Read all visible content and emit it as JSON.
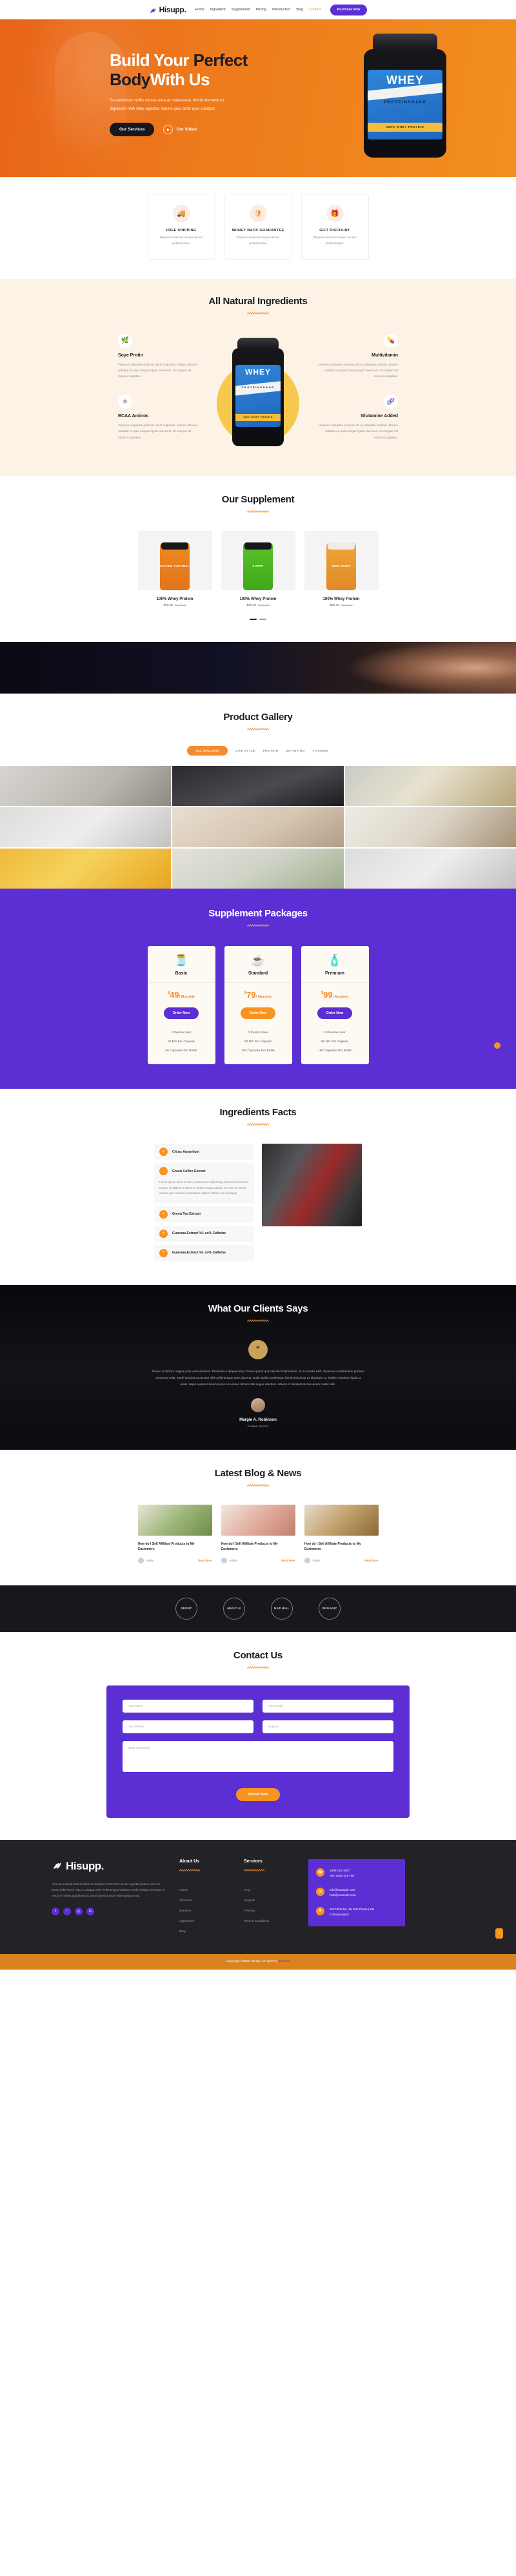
{
  "header": {
    "logo_text": "Hisupp.",
    "logo_icon": "leaf-icon",
    "nav": [
      {
        "label": "Home",
        "active": false
      },
      {
        "label": "Ingredient",
        "active": false
      },
      {
        "label": "Supplement",
        "active": false
      },
      {
        "label": "Pricing",
        "active": false
      },
      {
        "label": "Introduction",
        "active": false
      },
      {
        "label": "Blog",
        "active": false
      },
      {
        "label": "Contact",
        "active": true
      }
    ],
    "purchase_label": "Purchase Now"
  },
  "hero": {
    "title_line1_white": "Build Your ",
    "title_line1_dark": "Perfect",
    "title_line2_dark": "Body",
    "title_line2_white": "With Us",
    "subtitle": "Suspendisse mollis cursus urna at malesuada. Morbi elementum dignissim nibh vitae egestas mauris quis dolor quis volutpat.",
    "primary_button": "Our Services",
    "video_label": "Our Video!",
    "product_label_main": "WHEY",
    "product_label_sub": "PROTEINSHAKE",
    "product_label_band": "100% WHEY PROTEIN"
  },
  "features": [
    {
      "icon": "truck-icon",
      "title": "FREE SHIPPING",
      "desc": "Bliquam euismod neque vel leo pellentesque"
    },
    {
      "icon": "shield-icon",
      "title": "MONEY BACK GUARANTEE",
      "desc": "Bliquam euismod neque vel leo pellentesque"
    },
    {
      "icon": "gift-icon",
      "title": "GIFT DISCOUNT",
      "desc": "Bliquam euismod neque vel leo pellentesque"
    }
  ],
  "natural": {
    "title": "All Natural Ingredients",
    "left": [
      {
        "icon": "leaf-icon",
        "glyph": "🌿",
        "title": "Soye Protin",
        "desc": "Vivamus vulputate pulvinar elit et vulputate. Nullam ultricies volutpat ex,quis congue ligula viverra et. Ut congue vel metus in dapibus."
      },
      {
        "icon": "atom-icon",
        "glyph": "⚛",
        "title": "BCAA Aminos",
        "desc": "Vivamus vulputate pulvinar elit et vulputate. Nullam ultricies volutpat ex,quis congue ligula viverra et. Ut congue vel metus in dapibus."
      }
    ],
    "right": [
      {
        "icon": "vitamin-bottle-icon",
        "glyph": "💊",
        "title": "Multivitamin",
        "desc": "Vivamus vulputate pulvinar elit et vulputate. Nullam ultricies volutpat ex,quis congue ligula viverra et. Ut congue vel metus in dapibus."
      },
      {
        "icon": "dna-icon",
        "glyph": "🧬",
        "title": "Glutamine Added",
        "desc": "Vivamus vulputate pulvinar elit et vulputate. Nullam ultricies volutpat ex,quis congue ligula viverra et. Ut congue vel metus in dapibus."
      }
    ],
    "product_label_main": "WHEY",
    "product_label_sub": "PROTEINSHAKE",
    "product_label_band": "100% WHEY PROTEIN"
  },
  "supplement": {
    "title": "Our Supplement",
    "products": [
      {
        "name": "100% Whey Protein",
        "price": "$95.00",
        "old_price": "$120.00",
        "tub_text": "SALTED CARAMEL",
        "tub_class": "orange"
      },
      {
        "name": "100% Whey Protein",
        "price": "$95.00",
        "old_price": "$120.00",
        "tub_text": "SUPPK",
        "tub_class": "green"
      },
      {
        "name": "100% Whey Protein",
        "price": "$95.00",
        "old_price": "$120.00",
        "tub_text": "100% WHEY",
        "tub_class": "amber"
      }
    ]
  },
  "gallery": {
    "title": "Product Gallery",
    "tabs": [
      {
        "label": "ALL GALLERY",
        "active": true
      },
      {
        "label": "LIFE STYLE",
        "active": false
      },
      {
        "label": "PROTEIN",
        "active": false
      },
      {
        "label": "NUTRITION",
        "active": false
      },
      {
        "label": "VITAMINS",
        "active": false
      }
    ]
  },
  "packages": {
    "title": "Supplement Packages",
    "plans": [
      {
        "icon": "green-jar-icon",
        "glyph": "🫙",
        "name": "Basic",
        "currency": "$",
        "price": "49",
        "period": "/ Monthly",
        "button": "Order Now",
        "button_style": "purple",
        "features": [
          "1 Person User",
          "30 MG Per Capsule",
          "60 Capsules Per Bottle"
        ]
      },
      {
        "icon": "coffee-cup-icon",
        "glyph": "☕",
        "name": "Standard",
        "currency": "$",
        "price": "79",
        "period": "/ Monthly",
        "button": "Order Now",
        "button_style": "orange",
        "features": [
          "3 Person User",
          "60 MG Per Capsule",
          "100 Capsules Per Bottle"
        ]
      },
      {
        "icon": "red-jar-icon",
        "glyph": "🧴",
        "name": "Premium",
        "currency": "$",
        "price": "99",
        "period": "/ Monthly",
        "button": "Order Now",
        "button_style": "purple",
        "features": [
          "10 Person User",
          "90 MG Per Capsule",
          "160 Capsules Per Bottle"
        ]
      }
    ]
  },
  "facts": {
    "title": "Ingredients Facts",
    "items": [
      {
        "title": "Citrus Aurantium",
        "open": false,
        "body": ""
      },
      {
        "title": "Green Coffee Extract",
        "open": true,
        "body": "Lorem ipsum dolor sit amet,consectetur adipisicing elit,sed do eiusmod tempor incididunt ut labore et dolore magna aliqua. Ut enim ad minim veniam,quis nostrud exercitation ullamco laboris nisi ut aliquip"
      },
      {
        "title": "Green Tea Extract",
        "open": false,
        "body": ""
      },
      {
        "title": "Guarana Extract %1 so% Caffeine",
        "open": false,
        "body": ""
      },
      {
        "title": "Guarana Extract %1 so% Caffeine",
        "open": false,
        "body": ""
      }
    ]
  },
  "testimonial": {
    "title": "What Our Clients Says",
    "badge_icon": "quote-icon",
    "quote": "Donec sit dictum magna pulvi vehicula lacus. Phasellus a aliquam erat. Donec ipsum quis nisi sit condimentum. At ac massa nibh. Vivamus condimentum pretium commodo nulla. Morbi suscipit accumsan nibh pellentesque ante placerat. Nulla facilisi scelerisque hendrerit lacinia ex dignissim at. Nullam maximus ligula ut amet nisipis euismod ipsum purus accumsan dictum felis augue interdum. Mauris et tincidunt dictum quam mattis felis.",
    "name": "Margie A. Robinson",
    "role": "Creative Director"
  },
  "blog": {
    "title": "Latest Blog & News",
    "posts": [
      {
        "title": "How do I Sell Affiliate Products to My Customers",
        "author": "Admin",
        "read_more": "Read More",
        "img": "b1"
      },
      {
        "title": "How do I Sell Affiliate Products to My Customers",
        "author": "Admin",
        "read_more": "Read More",
        "img": "b2"
      },
      {
        "title": "How do I Sell Affiliate Products to My Customers",
        "author": "Admin",
        "read_more": "Read More",
        "img": "b3"
      }
    ]
  },
  "brands": [
    {
      "label": "SPORT"
    },
    {
      "label": "MUSCLE"
    },
    {
      "label": "NATURAL"
    },
    {
      "label": "ORGANIC"
    }
  ],
  "contact": {
    "title": "Contact Us",
    "name_placeholder": "Your Name",
    "email_placeholder": "Your Email",
    "phone_placeholder": "Your Phone",
    "subject_placeholder": "Subject",
    "comments_placeholder": "Write comments",
    "submit_label": "Submit Now"
  },
  "footer": {
    "logo_text": "Hisupp.",
    "logo_icon": "leaf-icon",
    "desc": "Aenean pulvinar laoreet tellus ut tincidunt. Praesent a lectus egestas,finibus enim sit amet,mollis lorem. Sed a volutpat velit. Pellentesque habitant morbi tristique senectus et netus et malesuada fames ac turpis egestas proin vitae egestas erat.",
    "socials": [
      {
        "icon": "facebook-icon",
        "glyph": "f"
      },
      {
        "icon": "twitter-icon",
        "glyph": "ᵗ"
      },
      {
        "icon": "instagram-icon",
        "glyph": "◎"
      },
      {
        "icon": "google-plus-icon",
        "glyph": "G"
      }
    ],
    "col1": {
      "title": "About Us",
      "links": [
        "Home",
        "About Us",
        "Services",
        "Appoiment",
        "Blog"
      ]
    },
    "col2": {
      "title": "Services",
      "links": [
        "FAQ",
        "Support",
        "Privercy",
        "Term & Conditions"
      ]
    },
    "contact_card": [
      {
        "icon": "phone-icon",
        "glyph": "☎",
        "line1": "1800-121-3637",
        "line2": "+91-7052-101-786"
      },
      {
        "icon": "mail-icon",
        "glyph": "✉",
        "line1": "info@example.com",
        "line2": "help@example.com"
      },
      {
        "icon": "location-icon",
        "glyph": "⚑",
        "line1": "1247/Plot No. 39,15th Phase,LHB",
        "line2": "Colony,Kanpur"
      }
    ],
    "to_top_icon": "arrow-up-icon",
    "copyright": "Copyright ©2021 Hisupp. All rights by",
    "copyright_link": "17sucai"
  }
}
